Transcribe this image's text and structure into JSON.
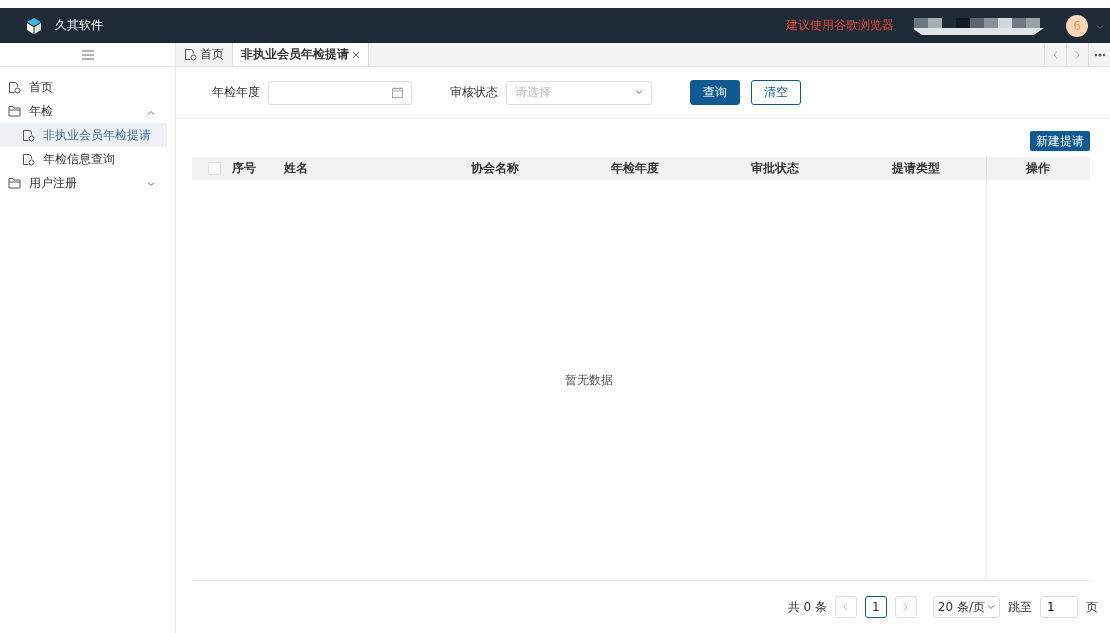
{
  "header": {
    "brand": "久其软件",
    "notice": "建议使用谷歌浏览器",
    "avatar": "6"
  },
  "sidebar": {
    "items": [
      {
        "label": "首页",
        "kind": "page",
        "selected": false
      },
      {
        "label": "年检",
        "kind": "folder",
        "expanded": true,
        "selected": false,
        "children": [
          {
            "label": "非执业会员年检提请",
            "kind": "page",
            "selected": true
          },
          {
            "label": "年检信息查询",
            "kind": "page",
            "selected": false
          }
        ]
      },
      {
        "label": "用户注册",
        "kind": "folder",
        "expanded": false,
        "selected": false
      }
    ]
  },
  "tabs": [
    {
      "label": "首页",
      "selected": false,
      "closable": false
    },
    {
      "label": "非执业会员年检提请",
      "selected": true,
      "closable": true
    }
  ],
  "filters": [
    {
      "label": "年检年度",
      "kind": "date"
    },
    {
      "label": "审核状态",
      "kind": "select",
      "placeholder": "请选择"
    }
  ],
  "buttons": [
    {
      "label": "查询",
      "kind": "primary"
    },
    {
      "label": "清空",
      "kind": "outline"
    }
  ],
  "new_button": "新建提请",
  "table": {
    "checked": false,
    "columns": [
      "序号",
      "姓名",
      "协会名称",
      "年检年度",
      "审批状态",
      "提请类型",
      "操作"
    ],
    "empty": "暂无数据"
  },
  "pagination": {
    "total": "共 0 条",
    "pages": [
      {
        "label": "1",
        "selected": true
      }
    ],
    "page_size": "20 条/页",
    "jump_label": "跳至",
    "jump_value": "1",
    "page_unit": "页"
  }
}
